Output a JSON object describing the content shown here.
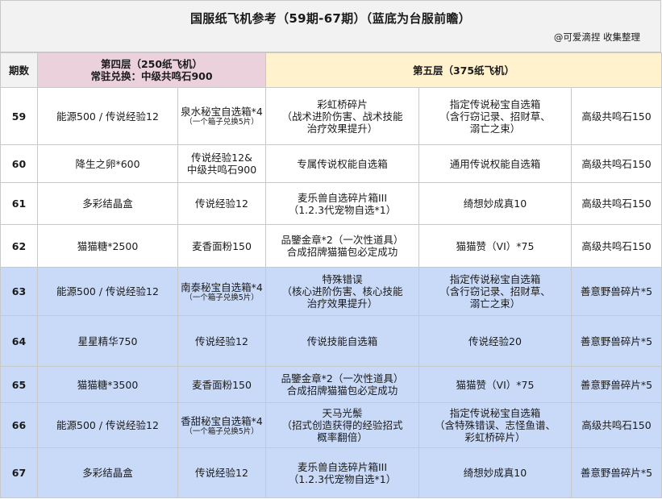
{
  "title": "国服纸飞机参考（59期-67期）（蓝底为台服前瞻）",
  "credit": "@可爱滴捏 收集整理",
  "header": {
    "period": "期数",
    "floor4_line1": "第四层（250纸飞机）",
    "floor4_line2": "常驻兑换：中级共鸣石900",
    "floor5": "第五层（375纸飞机）"
  },
  "rows": [
    {
      "period": "59",
      "f4a": "能源500 / 传说经验12",
      "f4b": [
        "泉水秘宝自选箱*4"
      ],
      "f4b_note": "（一个箱子兑换5片）",
      "f5a": [
        "彩虹桥碎片",
        "（战术进阶伤害、战术技能",
        "治疗效果提升）"
      ],
      "f5b": [
        "指定传说秘宝自选箱",
        "（含行窃记录、招财草、",
        "溺亡之束）"
      ],
      "f5c": "高级共鸣石150"
    },
    {
      "period": "60",
      "f4a": "降生之卵*600",
      "f4b": [
        "传说经验12&",
        "中级共鸣石900"
      ],
      "f4b_note": "",
      "f5a": [
        "专属传说权能自选箱"
      ],
      "f5b": [
        "通用传说权能自选箱"
      ],
      "f5c": "高级共鸣石150"
    },
    {
      "period": "61",
      "f4a": "多彩结晶盒",
      "f4b": [
        "传说经验12"
      ],
      "f4b_note": "",
      "f5a": [
        "麦乐兽自选碎片箱III",
        "（1.2.3代宠物自选*1）"
      ],
      "f5b": [
        "绮想妙成真10"
      ],
      "f5c": "高级共鸣石150"
    },
    {
      "period": "62",
      "f4a": "猫猫糖*2500",
      "f4b": [
        "麦香面粉150"
      ],
      "f4b_note": "",
      "f5a": [
        "品鑒金章*2（一次性道具）",
        "合成招牌猫猫包必定成功"
      ],
      "f5b": [
        "猫猫赞（VI）*75"
      ],
      "f5c": "高级共鸣石150"
    },
    {
      "period": "63",
      "f4a": "能源500 / 传说经验12",
      "f4b": [
        "南泰秘宝自选箱*4"
      ],
      "f4b_note": "（一个箱子兑换5片）",
      "f5a": [
        "特殊错误",
        "（核心进阶伤害、核心技能",
        "治疗效果提升）"
      ],
      "f5b": [
        "指定传说秘宝自选箱",
        "（含行窃记录、招财草、",
        "溺亡之束）"
      ],
      "f5c": "善意野兽碎片*5"
    },
    {
      "period": "64",
      "f4a": "星星精华750",
      "f4b": [
        "传说经验12"
      ],
      "f4b_note": "",
      "f5a": [
        "传说技能自选箱"
      ],
      "f5b": [
        "传说经验20"
      ],
      "f5c": "善意野兽碎片*5"
    },
    {
      "period": "65",
      "f4a": "猫猫糖*3500",
      "f4b": [
        "麦香面粉150"
      ],
      "f4b_note": "",
      "f5a": [
        "品鑒金章*2（一次性道具）",
        "合成招牌猫猫包必定成功"
      ],
      "f5b": [
        "猫猫赞（VI）*75"
      ],
      "f5c": "善意野兽碎片*5"
    },
    {
      "period": "66",
      "f4a": "能源500 / 传说经验12",
      "f4b": [
        "香甜秘宝自选箱*4"
      ],
      "f4b_note": "（一个箱子兑换5片）",
      "f5a": [
        "天马光鬃",
        "（招式创造获得的经验招式",
        "概率翻倍）"
      ],
      "f5b": [
        "指定传说秘宝自选箱",
        "（含特殊错误、志怪鱼谱、",
        "彩虹桥碎片）"
      ],
      "f5c": "高级共鸣石150"
    },
    {
      "period": "67",
      "f4a": "多彩结晶盒",
      "f4b": [
        "传说经验12"
      ],
      "f4b_note": "",
      "f5a": [
        "麦乐兽自选碎片箱III",
        "（1.2.3代宠物自选*1）"
      ],
      "f5b": [
        "绮想妙成真10"
      ],
      "f5c": "善意野兽碎片*5"
    }
  ],
  "colors": {
    "header_gray": "#f2f2f2",
    "floor4_pink": "#ead1dc",
    "floor5_yellow": "#fff2cc",
    "taiwan_preview_blue": "#c9daf8"
  }
}
